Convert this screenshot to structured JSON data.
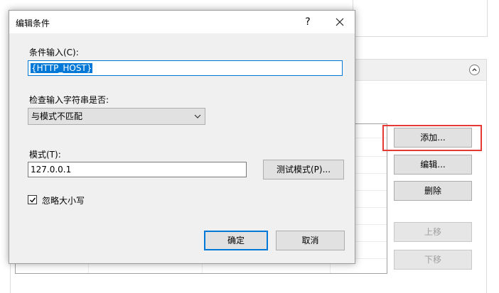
{
  "background": {
    "side_buttons": {
      "add": "添加...",
      "edit": "编辑...",
      "delete": "删除",
      "move_up": "上移",
      "move_down": "下移"
    },
    "highlight_color": "#e53935"
  },
  "dialog": {
    "title": "编辑条件",
    "help_label": "?",
    "condition_input": {
      "label": "条件输入(C):",
      "value": "{HTTP_HOST}"
    },
    "check_type": {
      "label": "检查输入字符串是否:",
      "selected": "与模式不匹配"
    },
    "pattern": {
      "label": "模式(T):",
      "value": "127.0.0.1",
      "test_button": "测试模式(P)..."
    },
    "ignore_case": {
      "label": "忽略大小写",
      "checked": true
    },
    "ok_button": "确定",
    "cancel_button": "取消"
  },
  "colors": {
    "accent": "#0078d7",
    "dialog_bg": "#f0f0f0",
    "button_bg": "#e1e1e1"
  },
  "icons": [
    "collapse-up-icon",
    "close-icon",
    "chevron-down-icon",
    "checkmark-icon"
  ]
}
